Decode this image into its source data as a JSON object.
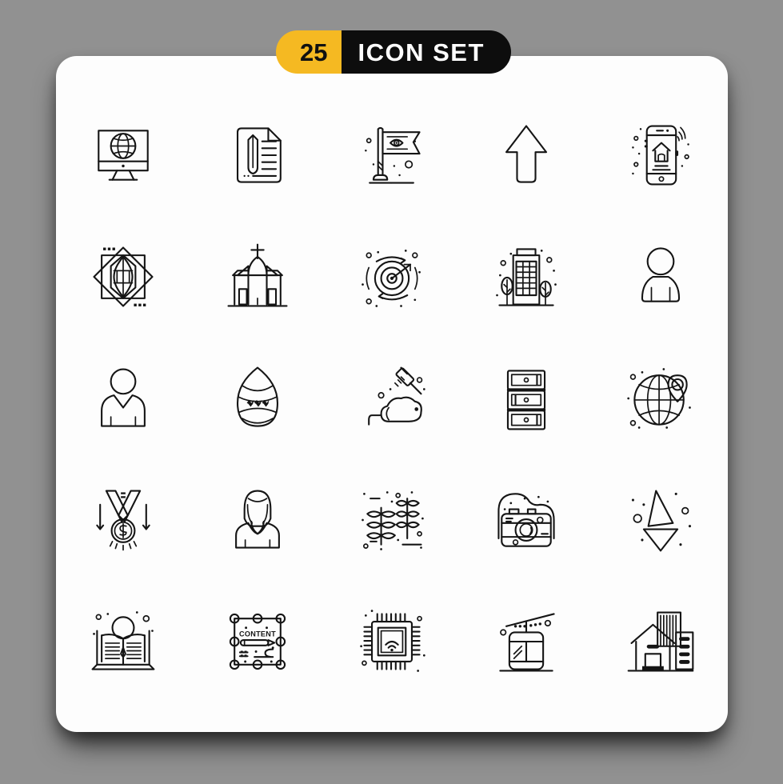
{
  "page": {
    "background_color": "#919191",
    "card_color": "#fdfdfd"
  },
  "header": {
    "count": "25",
    "title": "ICON SET",
    "count_bg": "#F5B922",
    "title_bg": "#0D0D0D",
    "count_text_color": "#111111",
    "title_text_color": "#FFFFFF"
  },
  "grid": {
    "columns": 5,
    "rows": 5,
    "total": 25,
    "stroke_color": "#151515",
    "icons": [
      {
        "index": 1,
        "name": "monitor-globe-icon",
        "label": "Desktop monitor with globe"
      },
      {
        "index": 2,
        "name": "document-pencil-icon",
        "label": "Document with pencil"
      },
      {
        "index": 3,
        "name": "flag-eye-icon",
        "label": "Flag with eye emblem"
      },
      {
        "index": 4,
        "name": "arrow-up-icon",
        "label": "Up arrow"
      },
      {
        "index": 5,
        "name": "smartphone-smart-home-icon",
        "label": "Smartphone smart home wifi"
      },
      {
        "index": 6,
        "name": "gem-frame-icon",
        "label": "Diamond gem in geometric frame"
      },
      {
        "index": 7,
        "name": "church-icon",
        "label": "Church building"
      },
      {
        "index": 8,
        "name": "radar-target-icon",
        "label": "Radar target scanner"
      },
      {
        "index": 9,
        "name": "office-building-trees-icon",
        "label": "Office building with trees"
      },
      {
        "index": 10,
        "name": "user-avatar-icon",
        "label": "User avatar"
      },
      {
        "index": 11,
        "name": "person-vneck-icon",
        "label": "Person in v-neck shirt"
      },
      {
        "index": 12,
        "name": "easter-egg-icon",
        "label": "Decorated easter egg"
      },
      {
        "index": 13,
        "name": "syringe-lab-mouse-icon",
        "label": "Syringe with lab mouse"
      },
      {
        "index": 14,
        "name": "server-rack-icon",
        "label": "Server rack drawers"
      },
      {
        "index": 15,
        "name": "globe-location-pin-icon",
        "label": "Globe with location pin"
      },
      {
        "index": 16,
        "name": "medal-dollar-icon",
        "label": "Medal with dollar sign"
      },
      {
        "index": 17,
        "name": "woman-avatar-icon",
        "label": "Woman avatar"
      },
      {
        "index": 18,
        "name": "plants-crops-icon",
        "label": "Plants and crops"
      },
      {
        "index": 19,
        "name": "camera-icon",
        "label": "Photo camera"
      },
      {
        "index": 20,
        "name": "arrow-down-icon",
        "label": "Stylized down arrow"
      },
      {
        "index": 21,
        "name": "book-search-icon",
        "label": "Open book with magnifier"
      },
      {
        "index": 22,
        "name": "content-editor-icon",
        "label": "Content editing box"
      },
      {
        "index": 23,
        "name": "chip-wifi-icon",
        "label": "Microchip with wifi"
      },
      {
        "index": 24,
        "name": "cable-car-icon",
        "label": "Cable car gondola"
      },
      {
        "index": 25,
        "name": "house-buildings-icon",
        "label": "House with buildings"
      }
    ]
  },
  "icon_text": {
    "content_label": "CONTENT"
  }
}
